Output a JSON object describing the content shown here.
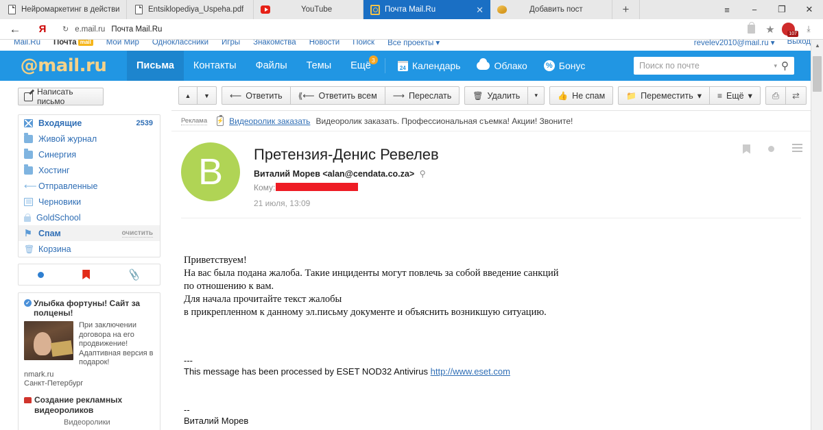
{
  "browser": {
    "tabs": [
      {
        "title": "Нейромаркетинг в действи",
        "icon": "document-icon",
        "active": false
      },
      {
        "title": "Entsiklopediya_Uspeha.pdf",
        "icon": "document-icon",
        "active": false
      },
      {
        "title": "YouTube",
        "icon": "youtube-icon",
        "active": false
      },
      {
        "title": "Почта Mail.Ru",
        "icon": "mailru-icon",
        "active": true
      },
      {
        "title": "Добавить пост",
        "icon": "bean-icon",
        "active": false
      }
    ],
    "new_tab_label": "+",
    "window_controls": {
      "menu": "≡",
      "minimize": "−",
      "restore": "❐",
      "close": "✕"
    },
    "nav": {
      "back": "←",
      "brand": "Я",
      "reload": "↻",
      "url_host": "e.mail.ru",
      "url_title": "Почта Mail.Ru",
      "lock": "lock-icon",
      "star": "★",
      "adblock_count": "107",
      "download": "⤓"
    }
  },
  "portal_nav": {
    "items": [
      {
        "label": "Mail.Ru",
        "badge": ""
      },
      {
        "label": "Почта",
        "badge": "mail",
        "active": true
      },
      {
        "label": "Мой Мир",
        "badge": ""
      },
      {
        "label": "Одноклассники",
        "badge": ""
      },
      {
        "label": "Игры",
        "badge": ""
      },
      {
        "label": "Знакомства",
        "badge": ""
      },
      {
        "label": "Новости",
        "badge": ""
      },
      {
        "label": "Поиск",
        "badge": ""
      },
      {
        "label": "Все проекты ▾",
        "badge": ""
      }
    ],
    "account": "revelev2010@mail.ru ▾",
    "logout": "Выход"
  },
  "header": {
    "logo_at": "@",
    "logo_text": "mail.ru",
    "tabs": [
      {
        "label": "Письма",
        "selected": true,
        "badge": ""
      },
      {
        "label": "Контакты",
        "selected": false,
        "badge": ""
      },
      {
        "label": "Файлы",
        "selected": false,
        "badge": ""
      },
      {
        "label": "Темы",
        "selected": false,
        "badge": ""
      },
      {
        "label": "Ещё",
        "selected": false,
        "badge": "3"
      }
    ],
    "links": [
      {
        "label": "Календарь",
        "icon": "calendar-icon",
        "day": "24"
      },
      {
        "label": "Облако",
        "icon": "cloud-icon"
      },
      {
        "label": "Бонус",
        "icon": "percent-icon"
      }
    ],
    "search": {
      "placeholder": "Поиск по почте",
      "value": "",
      "caret": "▾",
      "magnifier": "search-icon"
    }
  },
  "sidebar": {
    "compose_label": "Написать письмо",
    "folders": [
      {
        "label": "Входящие",
        "count": "2539",
        "icon": "inbox-icon",
        "bold": true,
        "selected": false,
        "action": ""
      },
      {
        "label": "Живой журнал",
        "count": "",
        "icon": "folder-icon",
        "bold": false,
        "selected": false,
        "action": ""
      },
      {
        "label": "Синергия",
        "count": "",
        "icon": "folder-icon",
        "bold": false,
        "selected": false,
        "action": ""
      },
      {
        "label": "Хостинг",
        "count": "",
        "icon": "folder-icon",
        "bold": false,
        "selected": false,
        "action": ""
      },
      {
        "label": "Отправленные",
        "count": "",
        "icon": "sent-icon",
        "bold": false,
        "selected": false,
        "action": ""
      },
      {
        "label": "Черновики",
        "count": "",
        "icon": "draft-icon",
        "bold": false,
        "selected": false,
        "action": ""
      },
      {
        "label": "GoldSchool",
        "count": "",
        "icon": "lock-folder-icon",
        "bold": false,
        "selected": false,
        "action": ""
      },
      {
        "label": "Спам",
        "count": "",
        "icon": "spam-icon",
        "bold": true,
        "selected": true,
        "action": "очистить"
      },
      {
        "label": "Корзина",
        "count": "",
        "icon": "trash-icon",
        "bold": false,
        "selected": false,
        "action": ""
      }
    ],
    "filters": [
      {
        "name": "unread-filter",
        "icon": "blue-dot-icon"
      },
      {
        "name": "flagged-filter",
        "icon": "red-flag-icon"
      },
      {
        "name": "attachment-filter",
        "icon": "paperclip-icon"
      }
    ],
    "ad1": {
      "title": "Улыбка фортуны! Сайт за полцены!",
      "text": "При заключении договора на его продвижение! Адаптивная версия в подарок!",
      "domain": "nmark.ru",
      "city": "Санкт-Петербург"
    },
    "ad2": {
      "title": "Создание рекламных видеороликов",
      "tail": "Видеоролики"
    }
  },
  "toolbar": {
    "prev_label": "▲",
    "next_label": "▼",
    "reply_label": "Ответить",
    "reply_all_label": "Ответить всем",
    "forward_label": "Переслать",
    "delete_label": "Удалить",
    "delete_caret": "▾",
    "not_spam_label": "Не спам",
    "move_label": "Переместить",
    "move_caret": "▾",
    "more_label": "Ещё",
    "more_caret": "▾",
    "print_icon": "printer-icon",
    "translate_icon": "translate-icon"
  },
  "ad_strip": {
    "label": "Реклама",
    "link": "Видеоролик заказать",
    "text": "Видеоролик заказать. Профессиональная съемка! Акции! Звоните!"
  },
  "message": {
    "avatar_letter": "В",
    "subject": "Претензия-Денис Ревелев",
    "from": "Виталий Морев <alan@cendata.co.za>",
    "search_sender": "⚲",
    "to_label": "Кому:",
    "to_value_redacted": true,
    "date": "21 июля, 13:09",
    "icons": {
      "bookmark": "bookmark-icon",
      "dot": "dot-icon",
      "menu": "menu-icon"
    },
    "body": {
      "lines": [
        "Приветствуем!",
        "На вас была подана жалоба. Такие инциденты могут повлечь за собой введение санкций",
        "по отношению к вам.",
        "Для начала прочитайте текст жалобы",
        "в прикрепленном к данному эл.письму документе и объяснить возникшую ситуацию."
      ],
      "sig_dashes_1": "---",
      "eset_text": "This message has been processed by ESET NOD32 Antivirus ",
      "eset_link": "http://www.eset.com",
      "sig_dashes_2": "--",
      "signature": "Виталий Морев"
    }
  }
}
